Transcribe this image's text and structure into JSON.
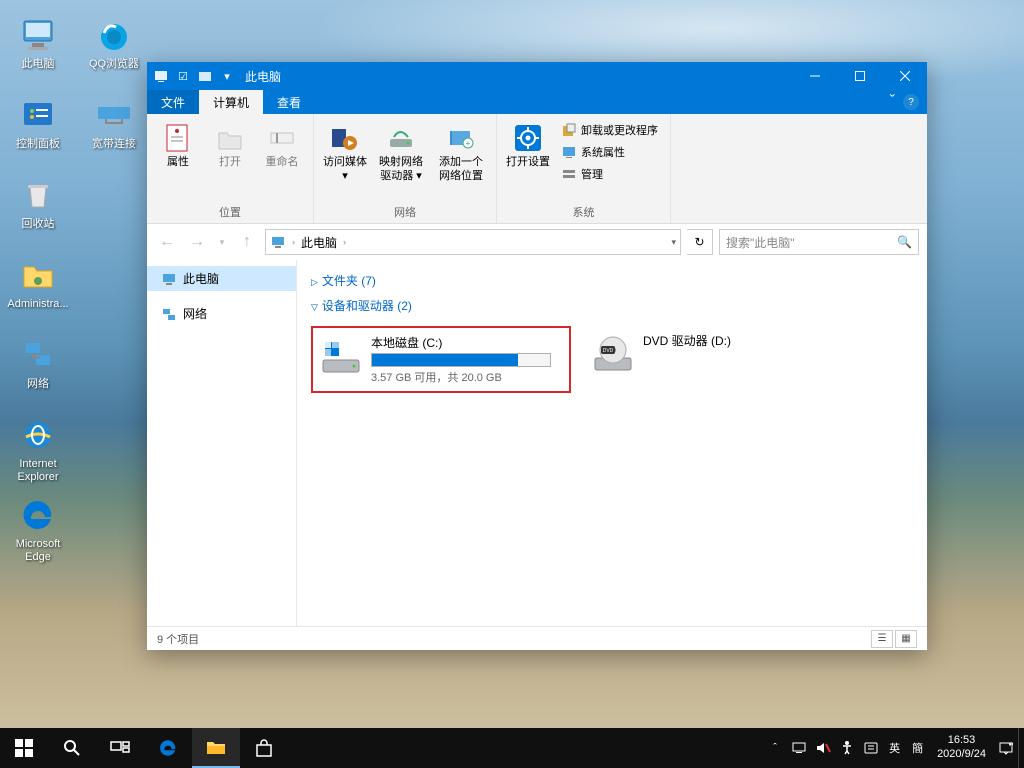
{
  "desktop": {
    "icons": [
      {
        "label": "此电脑",
        "icon": "pc"
      },
      {
        "label": "QQ浏览器",
        "icon": "qq"
      },
      {
        "label": "控制面板",
        "icon": "control"
      },
      {
        "label": "宽带连接",
        "icon": "broadband"
      },
      {
        "label": "回收站",
        "icon": "recycle"
      },
      {
        "label": "Administra...",
        "icon": "folder"
      },
      {
        "label": "网络",
        "icon": "network"
      },
      {
        "label": "Internet Explorer",
        "icon": "ie"
      },
      {
        "label": "Microsoft Edge",
        "icon": "edge"
      }
    ]
  },
  "window": {
    "title": "此电脑",
    "menu": {
      "file": "文件",
      "computer": "计算机",
      "view": "查看"
    },
    "ribbon": {
      "groups": {
        "location": {
          "label": "位置",
          "properties": "属性",
          "open": "打开",
          "rename": "重命名"
        },
        "network": {
          "label": "网络",
          "media": "访问媒体",
          "mapdrive": "映射网络驱动器",
          "addloc": "添加一个网络位置"
        },
        "system": {
          "label": "系统",
          "settings": "打开设置",
          "uninstall": "卸载或更改程序",
          "sysprops": "系统属性",
          "manage": "管理"
        }
      }
    },
    "nav": {
      "address_root": "此电脑",
      "search_placeholder": "搜索\"此电脑\""
    },
    "navpane": {
      "thispc": "此电脑",
      "network": "网络"
    },
    "content": {
      "folders_header": "文件夹 (7)",
      "devices_header": "设备和驱动器 (2)",
      "drive_c": {
        "name": "本地磁盘 (C:)",
        "meta": "3.57 GB 可用，共 20.0 GB",
        "used_pct": 82
      },
      "drive_d": {
        "name": "DVD 驱动器 (D:)"
      }
    },
    "status": "9 个项目"
  },
  "taskbar": {
    "clock_time": "16:53",
    "clock_date": "2020/9/24",
    "ime1": "英",
    "ime2": "簡"
  }
}
